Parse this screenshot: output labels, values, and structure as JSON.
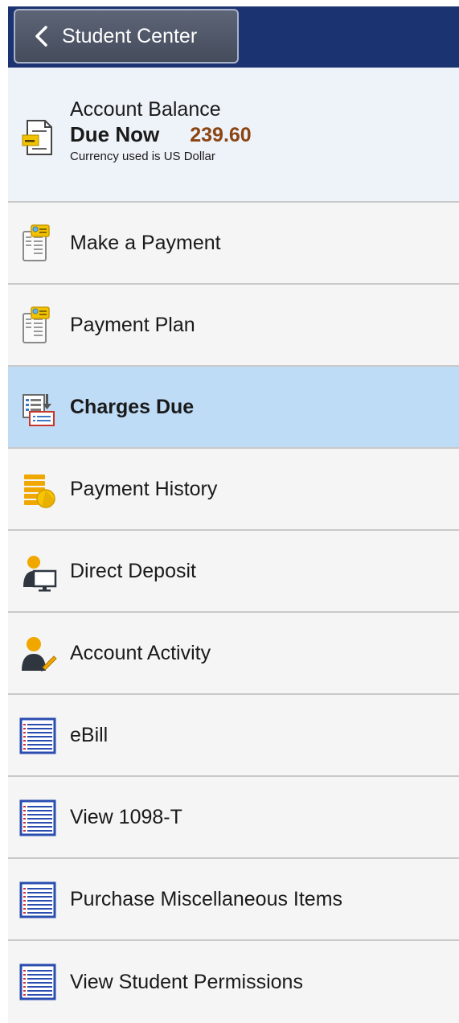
{
  "header": {
    "back_label": "Student Center",
    "back_icon": "chevron-left-icon"
  },
  "balance": {
    "title": "Account Balance",
    "due_label": "Due Now",
    "due_amount": "239.60",
    "currency_note": "Currency used is US Dollar",
    "icon": "bill-document-icon"
  },
  "menu": {
    "selected_index": 2,
    "items": [
      {
        "label": "Make a Payment",
        "icon": "payment-form-icon"
      },
      {
        "label": "Payment Plan",
        "icon": "payment-form-icon"
      },
      {
        "label": "Charges Due",
        "icon": "charges-list-icon"
      },
      {
        "label": "Payment History",
        "icon": "coin-stack-icon"
      },
      {
        "label": "Direct Deposit",
        "icon": "person-monitor-icon"
      },
      {
        "label": "Account Activity",
        "icon": "person-pencil-icon"
      },
      {
        "label": "eBill",
        "icon": "list-document-icon"
      },
      {
        "label": "View 1098-T",
        "icon": "list-document-icon"
      },
      {
        "label": "Purchase Miscellaneous Items",
        "icon": "list-document-icon"
      },
      {
        "label": "View Student Permissions",
        "icon": "list-document-icon"
      }
    ]
  },
  "colors": {
    "header_bg": "#1c3371",
    "selected_bg": "#bfdcf7",
    "amount": "#8b4513"
  }
}
